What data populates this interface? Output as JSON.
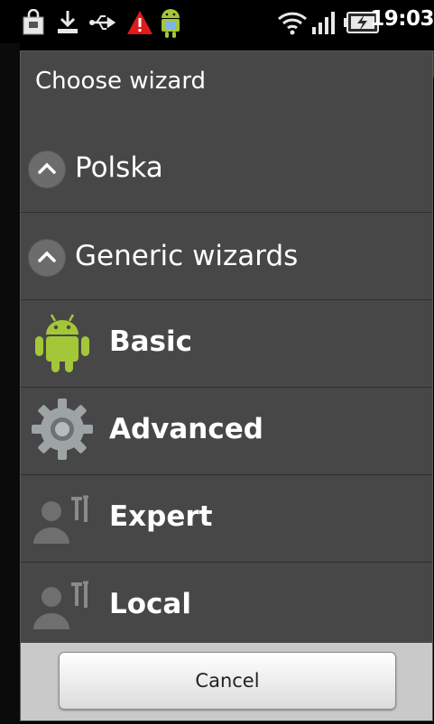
{
  "status_bar": {
    "time": "19:03",
    "icons": [
      "shopping-bag-icon",
      "download-icon",
      "usb-icon",
      "warning-icon",
      "android-icon",
      "wifi-icon",
      "signal-icon",
      "battery-charging-icon"
    ]
  },
  "dialog": {
    "title": "Choose wizard",
    "groups": [
      {
        "label": "Polska",
        "expanded": false
      },
      {
        "label": "Generic wizards",
        "expanded": true
      }
    ],
    "items": [
      {
        "label": "Basic",
        "icon": "android-robot-icon"
      },
      {
        "label": "Advanced",
        "icon": "gear-icon"
      },
      {
        "label": "Expert",
        "icon": "user-tools-icon"
      },
      {
        "label": "Local",
        "icon": "user-tools-icon"
      }
    ],
    "cancel_label": "Cancel"
  },
  "colors": {
    "dialog_bg": "#474747",
    "android_green": "#a4c639",
    "warning_red": "#e01a1a"
  }
}
